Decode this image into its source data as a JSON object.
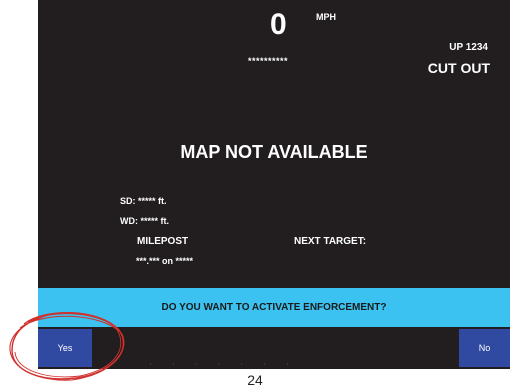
{
  "display": {
    "speed_value": "0",
    "speed_unit": "MPH",
    "masked_field": "**********",
    "train_id": "UP 1234",
    "status": "CUT OUT",
    "map_message": "MAP NOT AVAILABLE",
    "sd": "SD:  ***** ft.",
    "wd": "WD:  ***** ft.",
    "milepost_label": "MILEPOST",
    "next_target_label": "NEXT TARGET:",
    "milepost_value": "***.*** on *****"
  },
  "prompt": {
    "message": "DO YOU WANT TO ACTIVATE ENFORCEMENT?",
    "yes_label": "Yes",
    "no_label": "No"
  },
  "page": {
    "number": "24"
  },
  "colors": {
    "screen_bg": "#221e1f",
    "banner_bg": "#3bc2f0",
    "button_bg": "#2f4aa0",
    "annotation_circle": "#d0312d"
  },
  "icons": {
    "annotation": "red-hand-drawn-circle"
  }
}
